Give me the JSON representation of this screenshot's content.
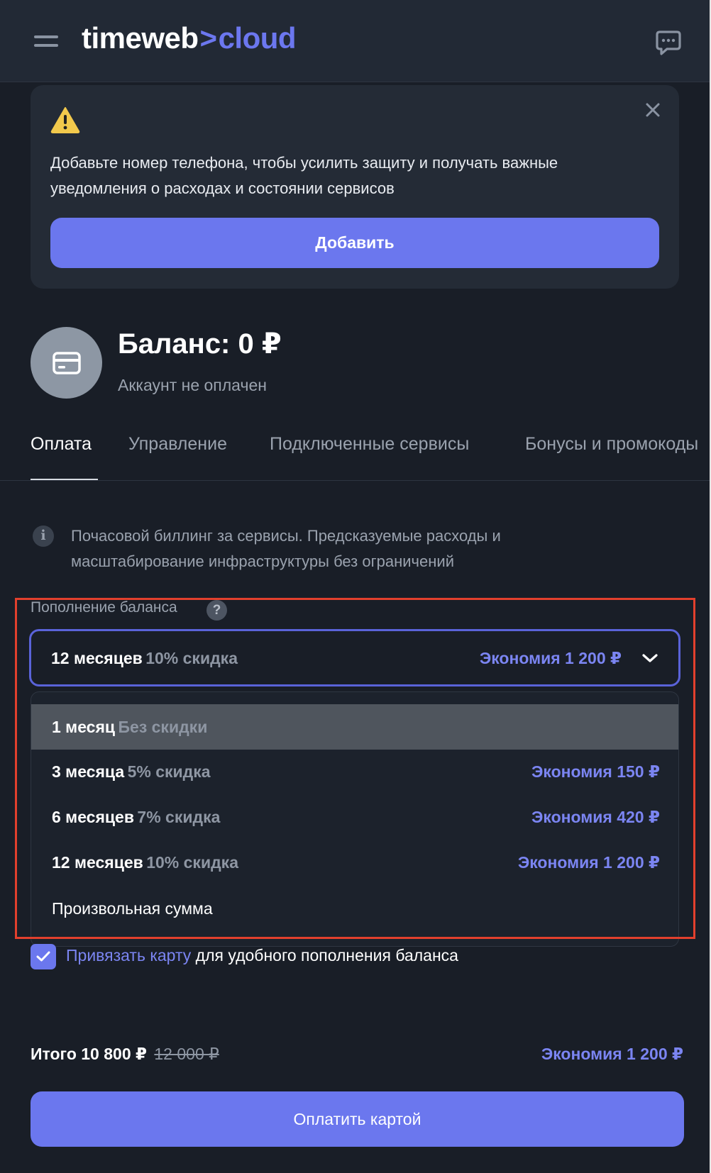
{
  "header": {
    "logo_word": "timeweb",
    "logo_chevron": ">",
    "logo_cloud": "cloud",
    "menu_icon": "hamburger-menu-icon",
    "chat_icon": "chat-bubble-icon"
  },
  "alert": {
    "icon": "warning-icon",
    "text": "Добавьте номер телефона, чтобы усилить защиту и получать важные уведомления о расходах и состоянии сервисов",
    "button_label": "Добавить",
    "close_icon": "close-icon"
  },
  "balance": {
    "title": "Баланс: 0 ₽",
    "status": "Аккаунт не оплачен",
    "icon": "credit-card-icon"
  },
  "tabs": [
    {
      "label": "Оплата",
      "active": true
    },
    {
      "label": "Управление",
      "active": false
    },
    {
      "label": "Подключенные сервисы",
      "active": false
    },
    {
      "label": "Бонусы и промокоды",
      "active": false
    }
  ],
  "info": {
    "icon": "info-icon",
    "text": "Почасовой биллинг за сервисы. Предсказуемые расходы и масштабирование инфраструктуры без ограничений"
  },
  "topup": {
    "label": "Пополнение баланса",
    "help_icon": "?",
    "selected": {
      "period": "12 месяцев",
      "discount": "10% скидка",
      "saving": "Экономия 1 200 ₽"
    },
    "options": [
      {
        "period": "1 месяц",
        "discount": "Без скидки",
        "saving": "",
        "highlighted": true
      },
      {
        "period": "3 месяца",
        "discount": "5% скидка",
        "saving": "Экономия 150 ₽",
        "highlighted": false
      },
      {
        "period": "6 месяцев",
        "discount": "7% скидка",
        "saving": "Экономия 420 ₽",
        "highlighted": false
      },
      {
        "period": "12 месяцев",
        "discount": "10% скидка",
        "saving": "Экономия 1 200 ₽",
        "highlighted": false
      },
      {
        "period": "Произвольная сумма",
        "discount": "",
        "saving": "",
        "highlighted": false
      }
    ]
  },
  "card_binding": {
    "checked": true,
    "link_text": "Привязать карту",
    "rest_text": " для удобного пополнения баланса"
  },
  "total": {
    "label": "Итого 10 800 ₽",
    "old_price": "12 000 ₽",
    "saving": "Экономия 1 200 ₽"
  },
  "pay_button_label": "Оплатить картой",
  "colors": {
    "background": "#191e27",
    "accent": "#6b77ee",
    "accent_text": "#7b85f2",
    "highlight_border": "#e2402d"
  }
}
